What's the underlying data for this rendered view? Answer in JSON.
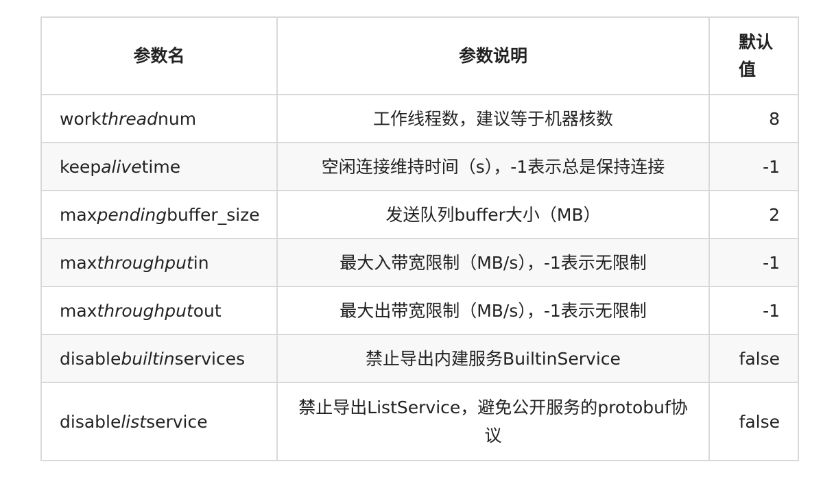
{
  "table": {
    "headers": {
      "name": "参数名",
      "description": "参数说明",
      "default": "默认值"
    },
    "rows": [
      {
        "name": {
          "pre": "work",
          "italic": "thread",
          "post": "num"
        },
        "description": "工作线程数，建议等于机器核数",
        "default": "8"
      },
      {
        "name": {
          "pre": "keep",
          "italic": "alive",
          "post": "time"
        },
        "description": "空闲连接维持时间（s），-1表示总是保持连接",
        "default": "-1"
      },
      {
        "name": {
          "pre": "max",
          "italic": "pending",
          "post": "buffer_size"
        },
        "description": "发送队列buffer大小（MB）",
        "default": "2"
      },
      {
        "name": {
          "pre": "max",
          "italic": "throughput",
          "post": "in"
        },
        "description": "最大入带宽限制（MB/s），-1表示无限制",
        "default": "-1"
      },
      {
        "name": {
          "pre": "max",
          "italic": "throughput",
          "post": "out"
        },
        "description": "最大出带宽限制（MB/s），-1表示无限制",
        "default": "-1"
      },
      {
        "name": {
          "pre": "disable",
          "italic": "builtin",
          "post": "services"
        },
        "description": "禁止导出内建服务BuiltinService",
        "default": "false"
      },
      {
        "name": {
          "pre": "disable",
          "italic": "list",
          "post": "service"
        },
        "description": "禁止导出ListService，避免公开服务的protobuf协议",
        "default": "false"
      }
    ]
  }
}
